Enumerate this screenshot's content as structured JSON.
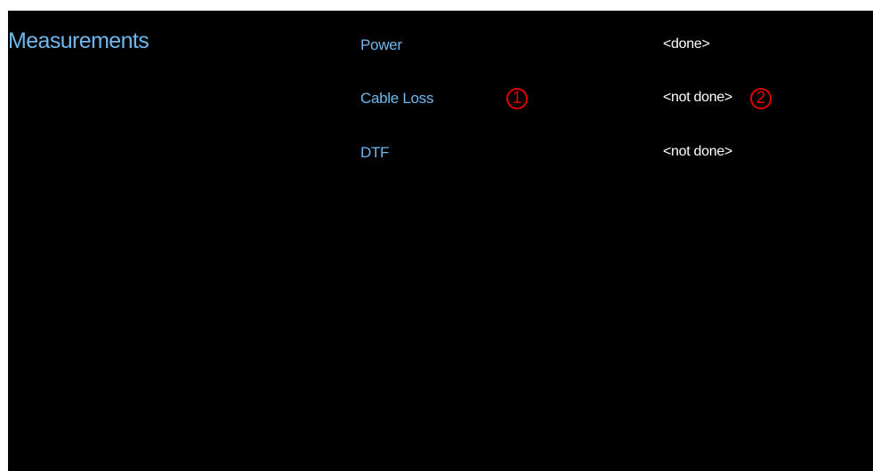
{
  "panel": {
    "title": "Measurements"
  },
  "measurements": [
    {
      "name": "Power",
      "status": "<done>"
    },
    {
      "name": "Cable Loss",
      "status": "<not done>"
    },
    {
      "name": "DTF",
      "status": "<not done>"
    }
  ],
  "callouts": {
    "marker_1": "1",
    "marker_2": "2",
    "color": "#e00000"
  },
  "colors": {
    "background": "#000000",
    "label": "#6fb8ee",
    "status": "#ffffff"
  }
}
